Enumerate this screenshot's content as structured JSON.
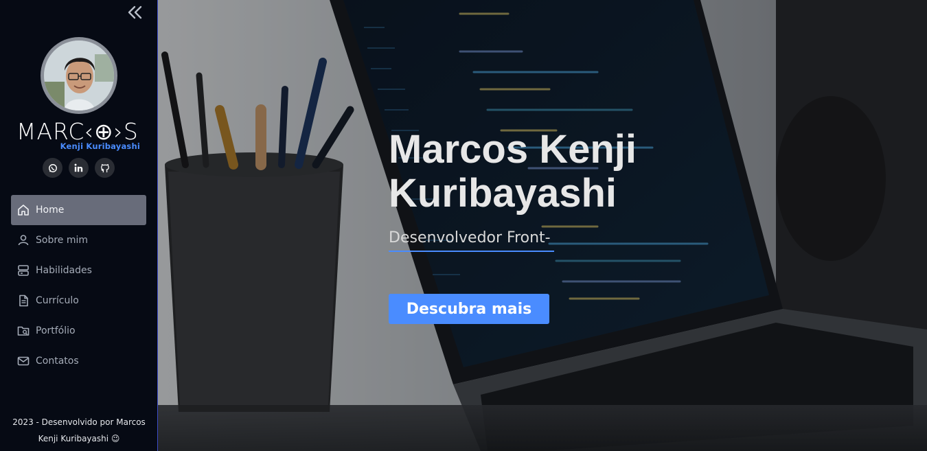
{
  "colors": {
    "sidebar_bg": "#060a14",
    "accent": "#4a8cff",
    "active_nav_bg": "#686c7a",
    "sidebar_border": "#3b4bc8"
  },
  "sidebar": {
    "collapse_icon": "double-chevron-left-icon",
    "logo": {
      "main": "MARC‹⊕›S",
      "sub": "Kenji Kuribayashi"
    },
    "socials": [
      {
        "name": "whatsapp",
        "icon": "whatsapp-icon"
      },
      {
        "name": "linkedin",
        "icon": "linkedin-icon"
      },
      {
        "name": "github",
        "icon": "github-icon"
      }
    ],
    "nav": [
      {
        "label": "Home",
        "icon": "home-icon",
        "active": true
      },
      {
        "label": "Sobre mim",
        "icon": "user-icon",
        "active": false
      },
      {
        "label": "Habilidades",
        "icon": "server-icon",
        "active": false
      },
      {
        "label": "Currículo",
        "icon": "document-icon",
        "active": false
      },
      {
        "label": "Portfólio",
        "icon": "folder-search-icon",
        "active": false
      },
      {
        "label": "Contatos",
        "icon": "mail-icon",
        "active": false
      }
    ],
    "footer_line1": "2023 - Desenvolvido por Marcos",
    "footer_line2": "Kenji Kuribayashi 😉"
  },
  "hero": {
    "title": "Marcos Kenji Kuribayashi",
    "subtitle": "Desenvolvedor Front-",
    "cta_label": "Descubra mais"
  }
}
